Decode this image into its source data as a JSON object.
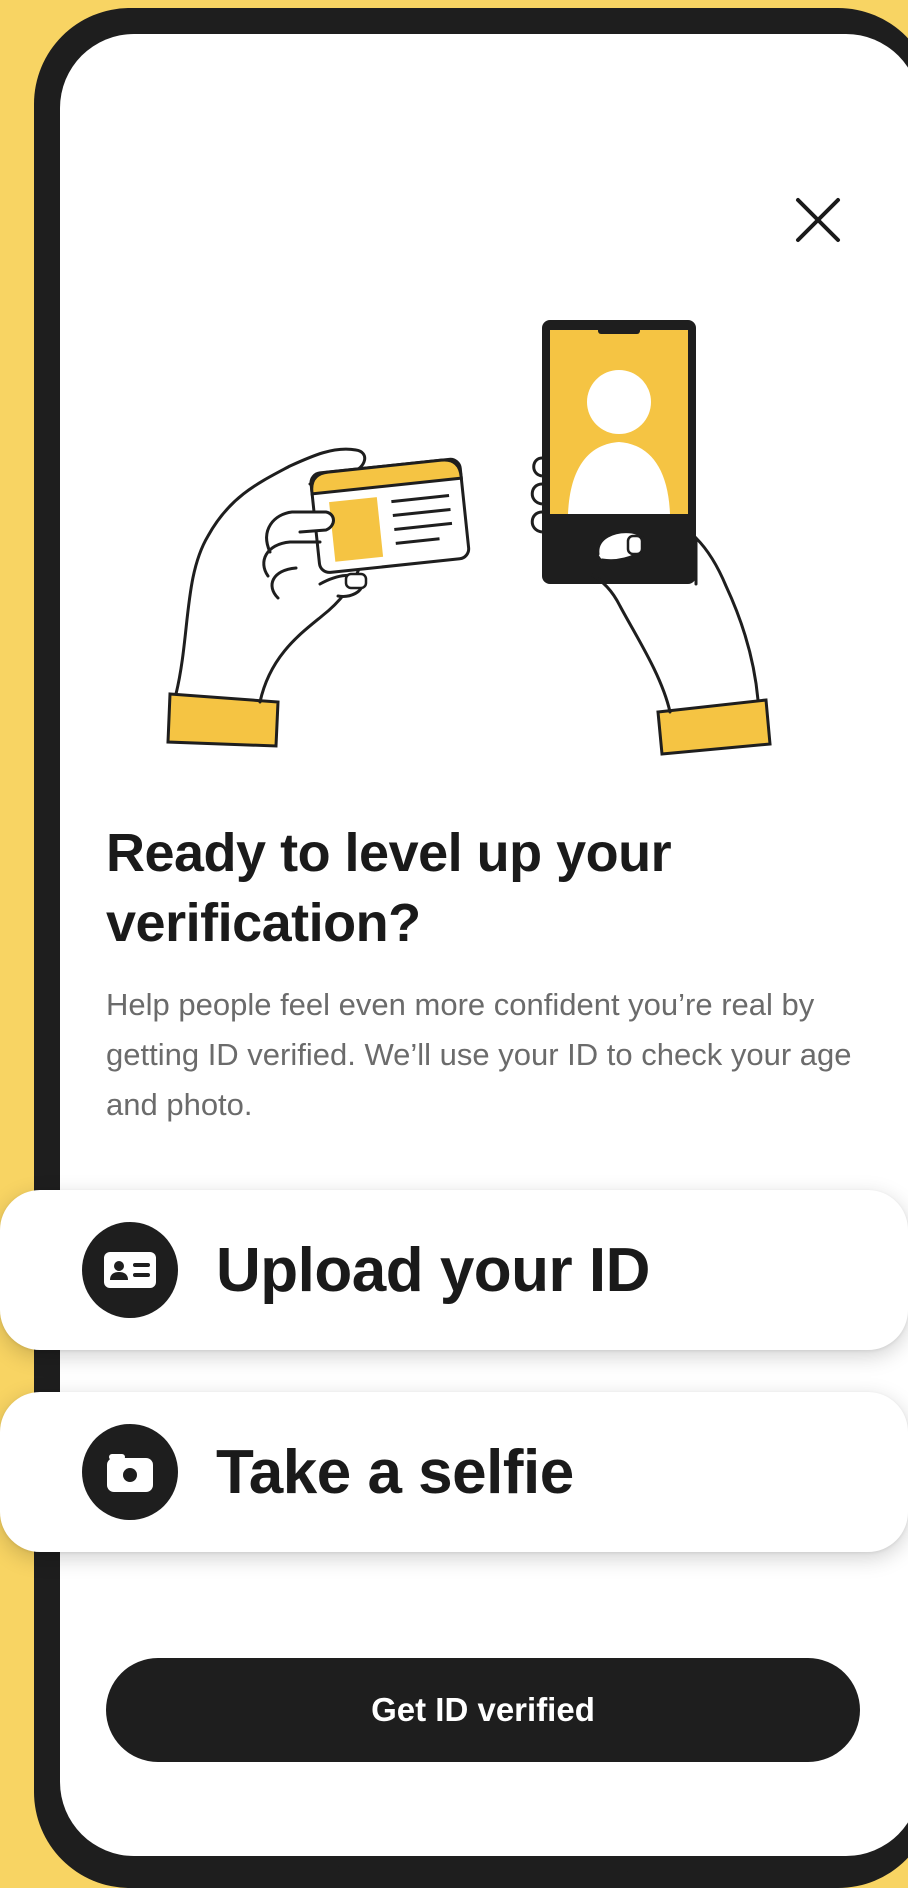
{
  "modal": {
    "close_icon": "close-icon",
    "illustration": "hands-holding-id-card-and-phone-selfie",
    "title": "Ready to level up your verification?",
    "body": "Help people feel even more confident you’re real by getting ID verified. We’ll use your ID to check your age and photo."
  },
  "options": [
    {
      "label": "Upload your ID",
      "icon": "id-card-icon"
    },
    {
      "label": "Take a selfie",
      "icon": "camera-icon"
    }
  ],
  "cta": {
    "label": "Get ID verified"
  },
  "colors": {
    "background": "#F8D463",
    "accent_yellow": "#F5C443",
    "ink": "#1E1E1E",
    "body_text": "#6B6B6B",
    "surface": "#FFFFFF"
  }
}
